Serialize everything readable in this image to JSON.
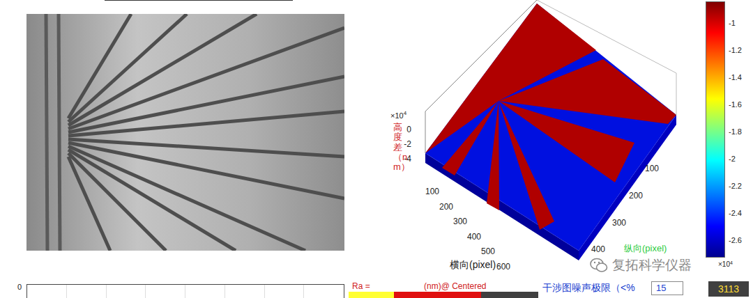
{
  "surface_plot": {
    "z_label": "高度差（nm）",
    "z_multiplier": "×10",
    "z_power": "4",
    "z_ticks": [
      "0",
      "-2",
      "-4"
    ],
    "x_label": "横向(pixel)",
    "x_ticks": [
      "100",
      "200",
      "300",
      "400",
      "500",
      "600"
    ],
    "y_label": "纵向(pixel)",
    "y_ticks": [
      "100",
      "200",
      "300",
      "400"
    ]
  },
  "colorbar": {
    "ticks": [
      "-1",
      "-1.2",
      "-1.4",
      "-1.6",
      "-1.8",
      "-2",
      "-2.2",
      "-2.4",
      "-2.6"
    ],
    "multiplier": "×10",
    "power": "4"
  },
  "watermark": {
    "text": "复拓科学仪器"
  },
  "profile_plot": {
    "y_ticks": [
      "0"
    ]
  },
  "results": {
    "ra_label": "Ra =",
    "ra_unit": "(nm)@ Centered"
  },
  "noise_limit": {
    "label": "干涉图噪声极限（<%",
    "value": "15",
    "count": "3113"
  }
}
